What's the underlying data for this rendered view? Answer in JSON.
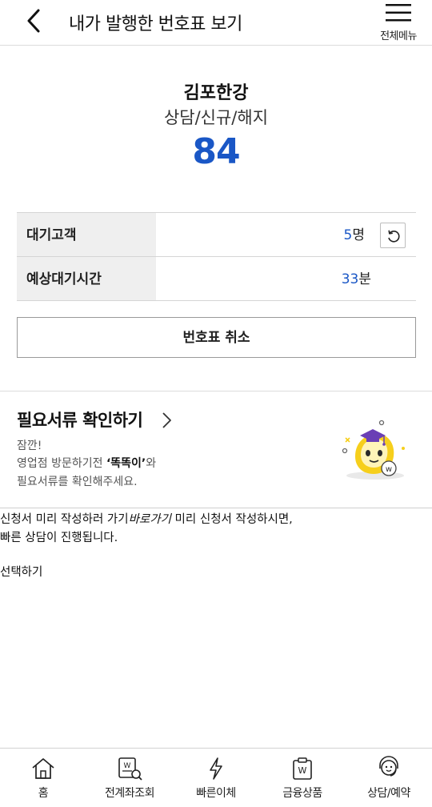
{
  "header": {
    "title": "내가 발행한 번호표 보기",
    "menu_label": "전체메뉴"
  },
  "ticket": {
    "branch": "김포한강",
    "service": "상담/신규/해지",
    "number": "84"
  },
  "info": {
    "wait_customers_label": "대기고객",
    "wait_customers_value": "5",
    "wait_customers_unit": "명",
    "wait_time_label": "예상대기시간",
    "wait_time_value": "33",
    "wait_time_unit": "분"
  },
  "cancel_label": "번호표 취소",
  "docs": {
    "title": "필요서류 확인하기",
    "line1": "잠깐!",
    "line2_prefix": "영업점 방문하기전 ",
    "line2_bold": "‘똑똑이’",
    "line2_suffix": "와",
    "line3": "필요서류를 확인해주세요."
  },
  "notice": {
    "part1": "신청서 미리 작성하러 가기",
    "link": "바로가기",
    "part2": " 미리 신청서 작성하시면,",
    "line2": "빠른 상담이 진행됩니다."
  },
  "select_label": "선택하기",
  "bottom_nav": [
    {
      "label": "홈",
      "icon": "home-icon"
    },
    {
      "label": "전계좌조회",
      "icon": "account-search-icon"
    },
    {
      "label": "빠른이체",
      "icon": "lightning-icon"
    },
    {
      "label": "금융상품",
      "icon": "product-icon"
    },
    {
      "label": "상담/예약",
      "icon": "consult-icon"
    }
  ],
  "colors": {
    "accent": "#1a57c6",
    "mascot_yellow": "#f6cf1c",
    "mascot_cap": "#6a3fb5"
  }
}
